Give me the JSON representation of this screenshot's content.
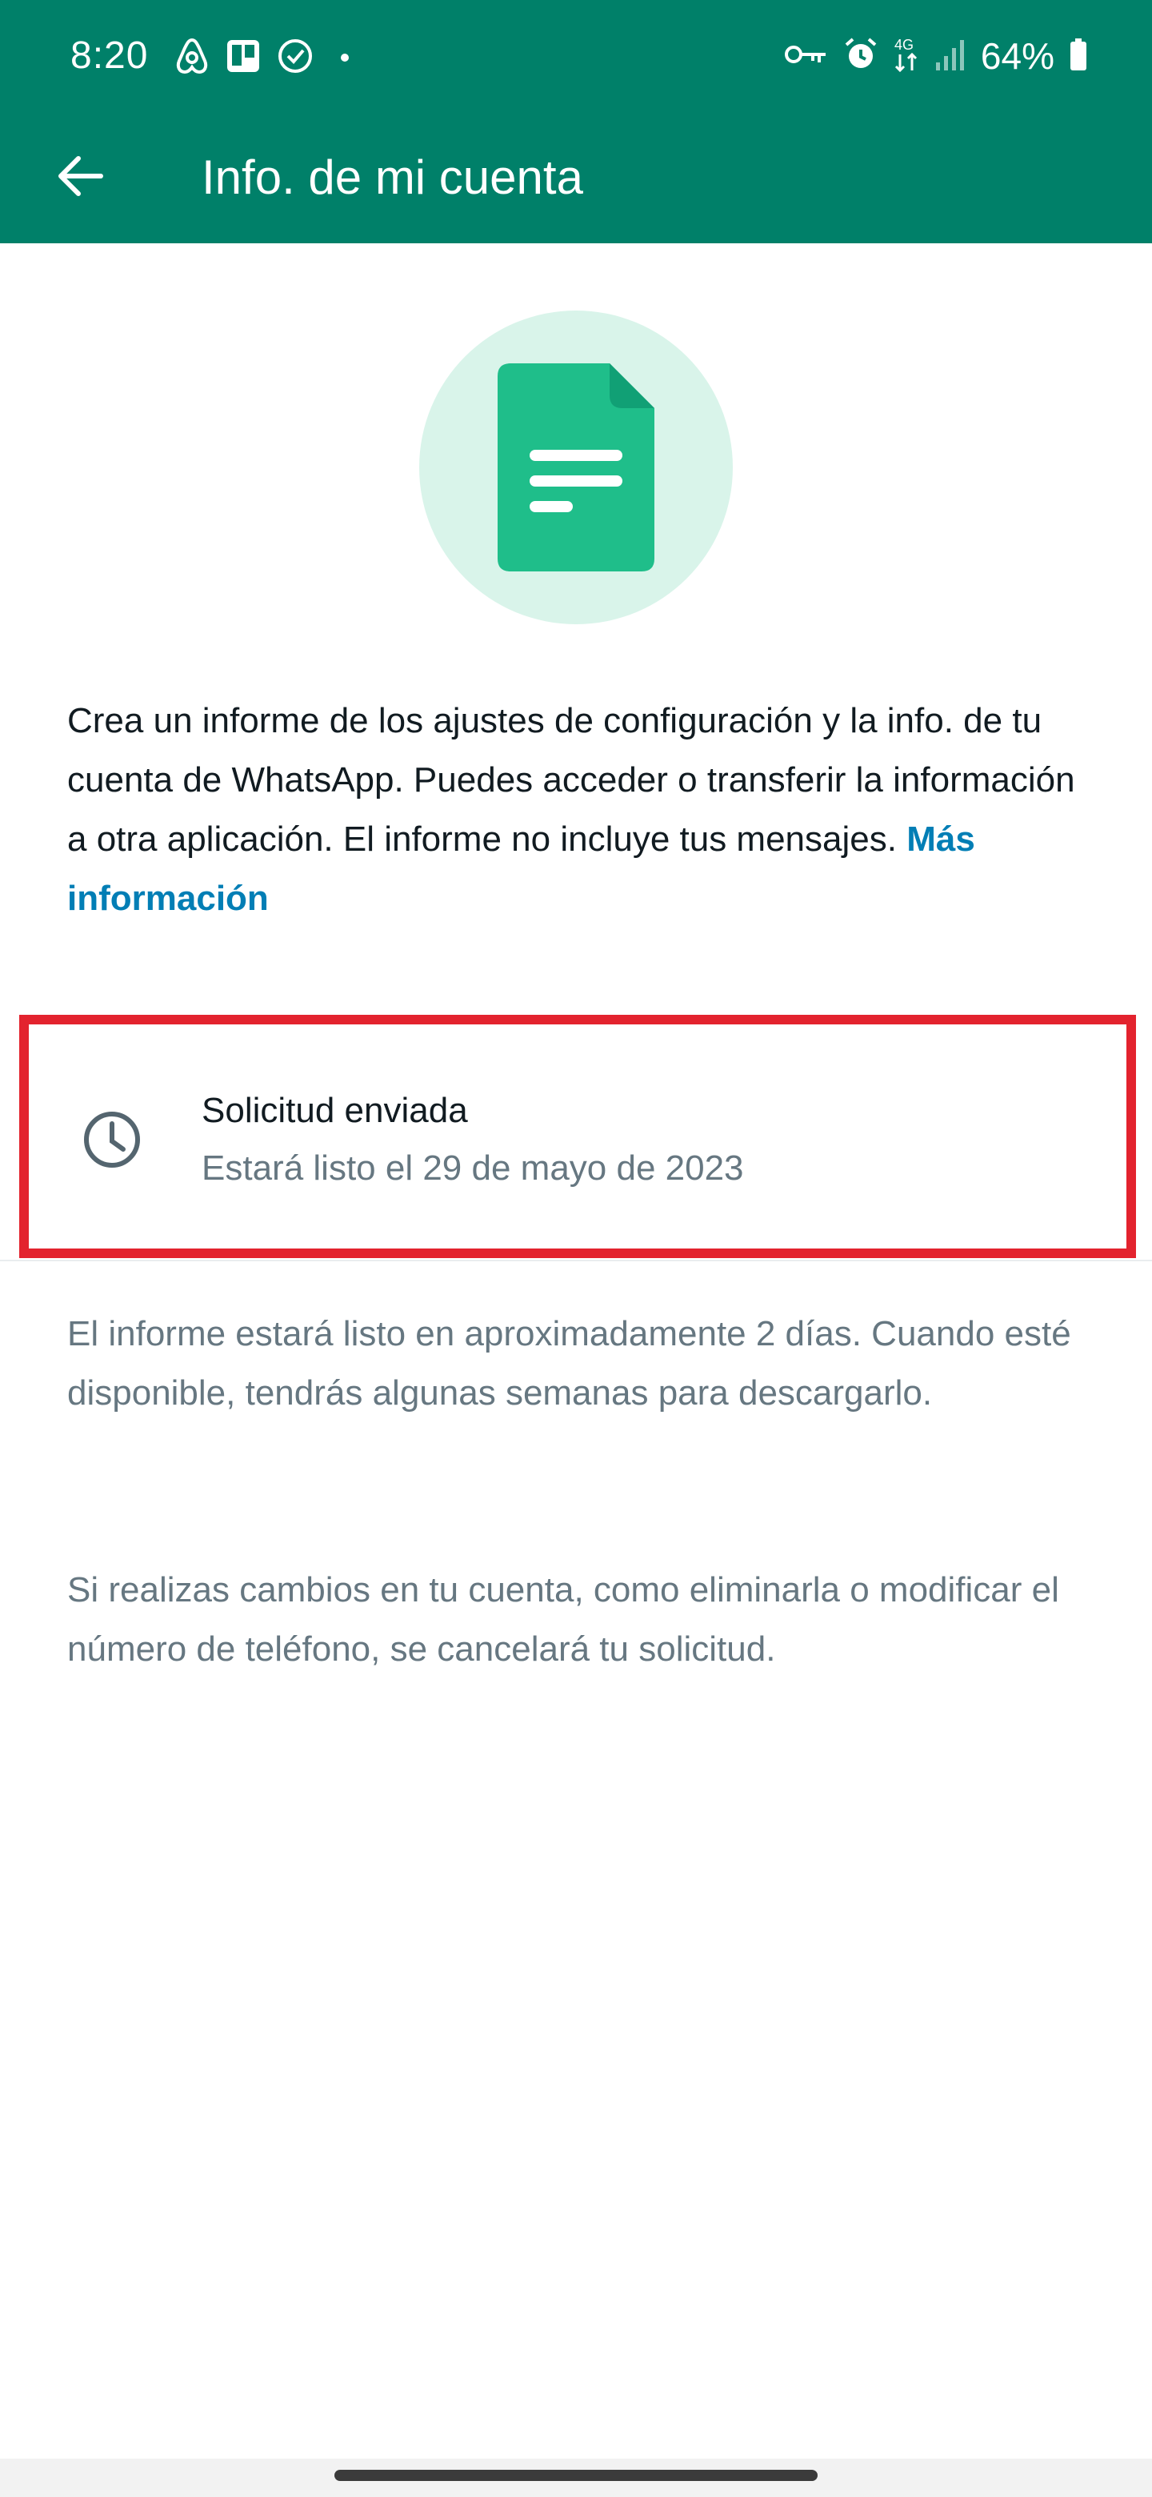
{
  "status_bar": {
    "time": "8:20",
    "battery": "64%",
    "left_icons": [
      "airbnb-icon",
      "trello-icon",
      "check-circle-icon",
      "notification-dot"
    ],
    "right_icons": [
      "vpn-key-icon",
      "alarm-icon",
      "data-4g-icon",
      "signal-icon",
      "battery-icon"
    ]
  },
  "app_bar": {
    "title": "Info. de mi cuenta",
    "back_icon": "arrow-back-icon",
    "color": "#008069"
  },
  "hero": {
    "icon": "document-icon",
    "circle_color": "#d9f4ea",
    "doc_color": "#1fbe8a"
  },
  "description": {
    "text": "Crea un informe de los ajustes de configuración y la info. de tu cuenta de WhatsApp. Puedes acceder o transferir la información a otra aplicación. El informe no incluye tus mensajes.",
    "link": "Más información",
    "link_color": "#027eb5"
  },
  "request": {
    "icon": "clock-icon",
    "title": "Solicitud enviada",
    "subtitle": "Estará listo el 29 de mayo de 2023",
    "highlight_color": "#e3232e"
  },
  "info": {
    "line1": "El informe estará listo en aproximadamente 2 días. Cuando esté disponible, tendrás algunas semanas para descargarlo.",
    "line2": "Si realizas cambios en tu cuenta, como eliminarla o modificar el número de teléfono, se cancelará tu solicitud."
  }
}
